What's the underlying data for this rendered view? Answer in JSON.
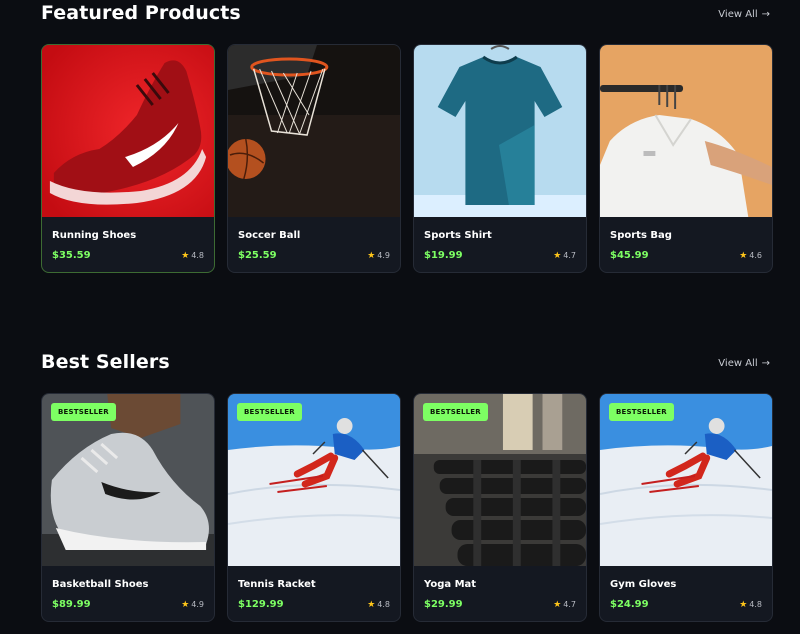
{
  "featured": {
    "title": "Featured Products",
    "view_all": "View All",
    "products": [
      {
        "name": "Running Shoes",
        "price": "$35.59",
        "rating": "4.8",
        "image": "red-running-shoe"
      },
      {
        "name": "Soccer Ball",
        "price": "$25.59",
        "rating": "4.9",
        "image": "basketball-hoop"
      },
      {
        "name": "Sports Shirt",
        "price": "$19.99",
        "rating": "4.7",
        "image": "teal-tshirt"
      },
      {
        "name": "Sports Bag",
        "price": "$45.99",
        "rating": "4.6",
        "image": "white-shirt-hanger"
      }
    ]
  },
  "best_sellers": {
    "title": "Best Sellers",
    "view_all": "View All",
    "badge": "BESTSELLER",
    "products": [
      {
        "name": "Basketball Shoes",
        "price": "$89.99",
        "rating": "4.9",
        "image": "grey-sneaker"
      },
      {
        "name": "Tennis Racket",
        "price": "$129.99",
        "rating": "4.8",
        "image": "skier"
      },
      {
        "name": "Yoga Mat",
        "price": "$29.99",
        "rating": "4.7",
        "image": "dumbbell-rack"
      },
      {
        "name": "Gym Gloves",
        "price": "$24.99",
        "rating": "4.8",
        "image": "skier"
      }
    ]
  },
  "colors": {
    "background": "#0b0d12",
    "card": "#141821",
    "price": "#7dff63",
    "badge": "#7dff63",
    "star": "#ffc61a"
  },
  "icons": {
    "arrow": "arrow-right-icon",
    "star": "star-icon"
  }
}
